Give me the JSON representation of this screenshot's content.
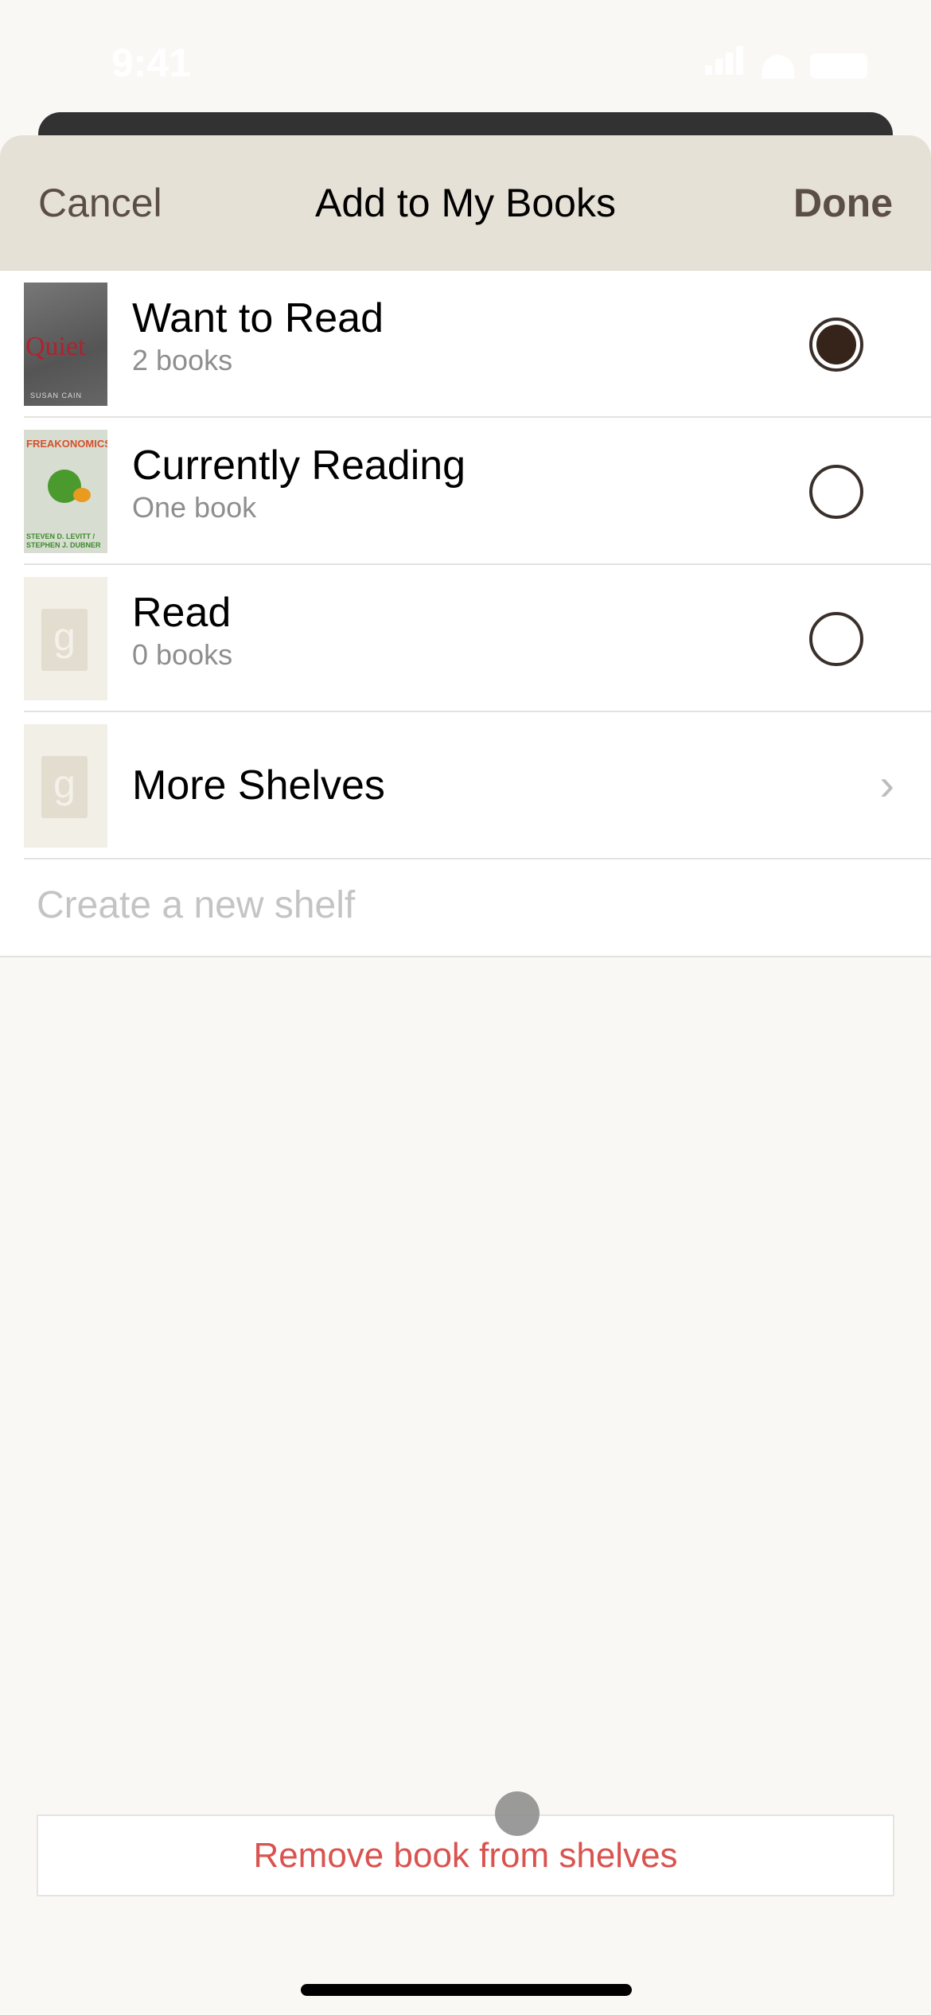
{
  "status_bar": {
    "time": "9:41",
    "icons": [
      "cellular-signal-icon",
      "wifi-icon",
      "battery-icon"
    ]
  },
  "header": {
    "cancel_label": "Cancel",
    "title": "Add to My Books",
    "done_label": "Done"
  },
  "shelves": [
    {
      "name": "Want to Read",
      "count": "2 books",
      "selected": true,
      "cover": "Quiet",
      "cover_author": "SUSAN CAIN"
    },
    {
      "name": "Currently Reading",
      "count": "One book",
      "selected": false,
      "cover": "FREAKONOMICS",
      "cover_author": "STEVEN D. LEVITT / STEPHEN J. DUBNER"
    },
    {
      "name": "Read",
      "count": "0 books",
      "selected": false,
      "cover": "g"
    }
  ],
  "more_shelves": {
    "label": "More Shelves",
    "cover": "g"
  },
  "create_shelf": {
    "placeholder": "Create a new shelf",
    "value": ""
  },
  "remove_label": "Remove book from shelves",
  "colors": {
    "header_bg": "#e6e1d6",
    "accent": "#5b4e46",
    "destructive": "#d9534f",
    "selected_radio": "#36231a"
  }
}
